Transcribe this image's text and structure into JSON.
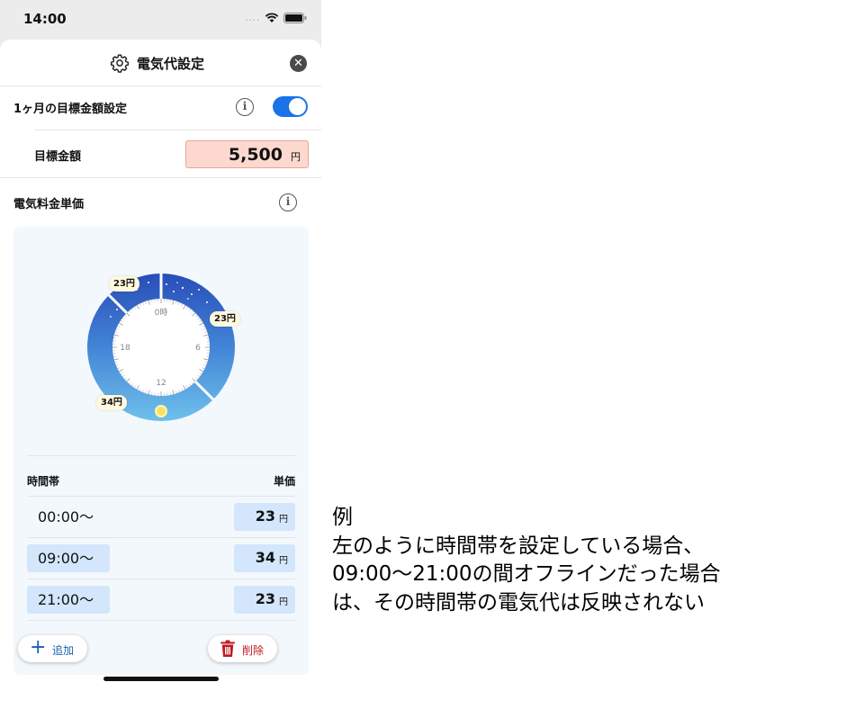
{
  "status_bar": {
    "time": "14:00",
    "dots": "...."
  },
  "sheet": {
    "title": "電気代設定",
    "monthly_target": {
      "label": "1ヶ月の目標金額設定",
      "enabled": true
    },
    "target_amount": {
      "label": "目標金額",
      "value": "5,500",
      "unit": "円"
    },
    "unit_price_section": {
      "label": "電気料金単価"
    }
  },
  "clock": {
    "hour_labels": [
      "0時",
      "6",
      "12",
      "18"
    ],
    "rate_tags": [
      "23円",
      "23円",
      "34円"
    ]
  },
  "table": {
    "header_time": "時間帯",
    "header_price": "単価",
    "rows": [
      {
        "time": "00:00～",
        "price": "23",
        "unit": "円"
      },
      {
        "time": "09:00～",
        "price": "34",
        "unit": "円"
      },
      {
        "time": "21:00～",
        "price": "23",
        "unit": "円"
      }
    ]
  },
  "buttons": {
    "add": "追加",
    "delete": "削除"
  },
  "note": {
    "lines": [
      "例",
      "左のように時間帯を設定している場合、",
      "09:00～21:00の間オフラインだった場合",
      "は、その時間帯の電気代は反映されない"
    ]
  },
  "colors": {
    "accent": "#1a73e8",
    "night_band": "#2d55c0",
    "day_band": "#5fb3e6",
    "target_bg": "#fdd8cf",
    "price_bg": "#d3e6fb",
    "delete": "#c0181e"
  }
}
